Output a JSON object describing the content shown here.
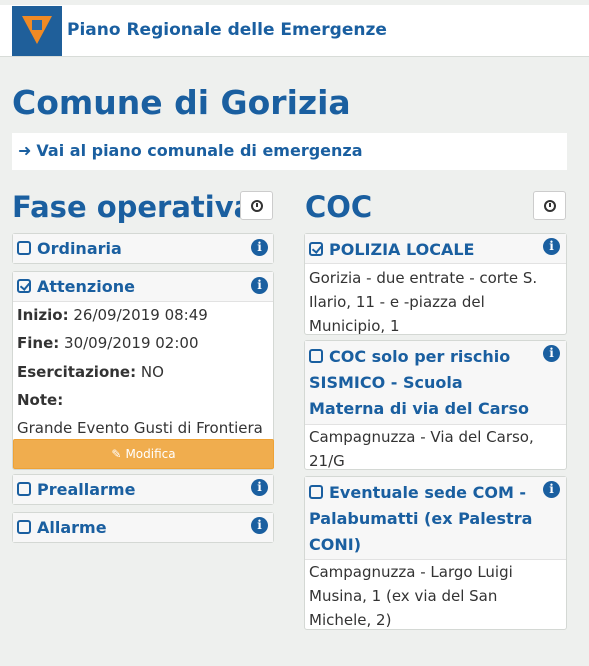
{
  "header": {
    "app_title": "Piano Regionale delle Emergenze",
    "logo_icon": "protezione-civile-logo"
  },
  "page": {
    "title": "Comune di Gorizia",
    "plan_link": "Vai al piano comunale di emergenza"
  },
  "phase": {
    "title": "Fase operativa",
    "items": [
      {
        "label": "Ordinaria",
        "checked": false
      },
      {
        "label": "Attenzione",
        "checked": true,
        "details": {
          "start_label": "Inizio:",
          "start_value": "26/09/2019 08:49",
          "end_label": "Fine:",
          "end_value": "30/09/2019 02:00",
          "drill_label": "Esercitazione:",
          "drill_value": "NO",
          "notes_label": "Note:",
          "notes_value": "Grande Evento Gusti di Frontiera"
        },
        "modify_label": "Modifica"
      },
      {
        "label": "Preallarme",
        "checked": false
      },
      {
        "label": "Allarme",
        "checked": false
      }
    ]
  },
  "coc": {
    "title": "COC",
    "items": [
      {
        "label": "POLIZIA LOCALE",
        "checked": true,
        "address": "Gorizia - due entrate - corte S. Ilario, 11 - e -piazza del Municipio, 1"
      },
      {
        "label": "COC solo per rischio SISMICO - Scuola Materna di via del Carso",
        "checked": false,
        "address": "Campagnuzza - Via del Carso, 21/G"
      },
      {
        "label": "Eventuale sede COM - Palabumatti (ex Palestra CONI)",
        "checked": false,
        "address": "Campagnuzza - Largo Luigi Musina, 1 (ex via del San Michele, 2)"
      }
    ]
  },
  "colors": {
    "primary": "#1a5fa0",
    "warning": "#f0ad4e",
    "background": "#eef0ee"
  }
}
